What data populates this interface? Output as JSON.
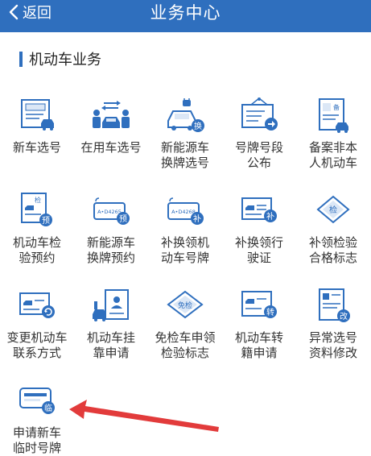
{
  "header": {
    "back_label": "返回",
    "title": "业务中心"
  },
  "section": {
    "title": "机动车业务"
  },
  "items": [
    {
      "label": "新车选号",
      "icon": "form-car-icon"
    },
    {
      "label": "在用车选号",
      "icon": "people-car-exchange-icon"
    },
    {
      "label": "新能源车\n换牌选号",
      "icon": "ev-car-swap-icon"
    },
    {
      "label": "号牌号段\n公布",
      "icon": "plate-notice-icon"
    },
    {
      "label": "备案非本\n人机动车",
      "icon": "record-document-icon"
    },
    {
      "label": "机动车检\n验预约",
      "icon": "inspection-appointment-icon"
    },
    {
      "label": "新能源车\n换牌预约",
      "icon": "plate-appointment-icon"
    },
    {
      "label": "补换领机\n动车号牌",
      "icon": "plate-replace-icon"
    },
    {
      "label": "补换领行\n驶证",
      "icon": "license-replace-icon"
    },
    {
      "label": "补领检验\n合格标志",
      "icon": "inspection-mark-icon"
    },
    {
      "label": "变更机动车\n联系方式",
      "icon": "contact-change-icon"
    },
    {
      "label": "机动车挂\n靠申请",
      "icon": "affiliation-apply-icon"
    },
    {
      "label": "免检车申领\n检验标志",
      "icon": "exempt-mark-icon"
    },
    {
      "label": "机动车转\n籍申请",
      "icon": "transfer-apply-icon"
    },
    {
      "label": "异常选号\n资料修改",
      "icon": "abnormal-edit-icon"
    },
    {
      "label": "申请新车\n临时号牌",
      "icon": "temp-plate-icon"
    }
  ],
  "icon_badges": {
    "ev": "换",
    "inspection": "检",
    "appointment": "预",
    "replace": "补",
    "mark": "检",
    "transfer": "转",
    "edit": "改",
    "temp": "临",
    "record": "备",
    "exempt": "免检",
    "plate_text": "A•D4268",
    "plate_text2": "A•D4265"
  },
  "colors": {
    "primary": "#2f6fbe",
    "arrow": "#e23b3b",
    "text": "#333333"
  }
}
